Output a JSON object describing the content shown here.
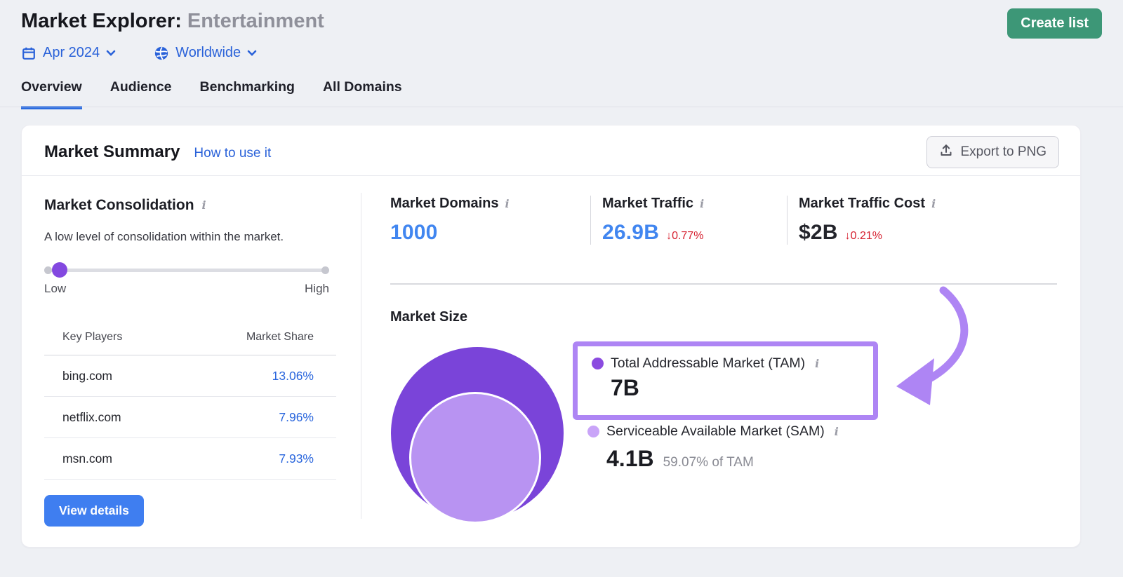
{
  "header": {
    "title_prefix": "Market Explorer:",
    "title_entity": "Entertainment",
    "create_list_button": "Create list",
    "date_filter": "Apr 2024",
    "region_filter": "Worldwide",
    "tabs": [
      {
        "label": "Overview",
        "active": true
      },
      {
        "label": "Audience",
        "active": false
      },
      {
        "label": "Benchmarking",
        "active": false
      },
      {
        "label": "All Domains",
        "active": false
      }
    ]
  },
  "summary_card": {
    "title": "Market Summary",
    "help_link": "How to use it",
    "export_button": "Export to PNG"
  },
  "consolidation": {
    "title": "Market Consolidation",
    "description": "A low level of consolidation within the market.",
    "slider": {
      "low": "Low",
      "high": "High",
      "level": "low"
    },
    "table": {
      "headers": [
        "Key Players",
        "Market Share"
      ],
      "rows": [
        {
          "domain": "bing.com",
          "share": "13.06%"
        },
        {
          "domain": "netflix.com",
          "share": "7.96%"
        },
        {
          "domain": "msn.com",
          "share": "7.93%"
        }
      ]
    },
    "view_details_button": "View details"
  },
  "stats": [
    {
      "label": "Market Domains",
      "value": "1000"
    },
    {
      "label": "Market Traffic",
      "value": "26.9B",
      "change": "↓0.77%"
    },
    {
      "label": "Market Traffic Cost",
      "value": "$2B",
      "change": "↓0.21%"
    }
  ],
  "market_size": {
    "title": "Market Size",
    "tam": {
      "label": "Total Addressable Market (TAM)",
      "value": "7B"
    },
    "sam": {
      "label": "Serviceable Available Market (SAM)",
      "value": "4.1B",
      "share_of_tam": "59.07% of TAM"
    }
  },
  "icons": {
    "date": "calendar-icon",
    "region": "globe-icon",
    "dropdowns": "chevron-down-icon",
    "export": "upload-icon",
    "tooltips": "info-icon",
    "negative_change": "down-arrow-glyph"
  },
  "colors": {
    "accent_blue": "#2a62d9",
    "value_blue": "#4186f0",
    "negative_red": "#d6202f",
    "green_button": "#3d9777",
    "primary_button": "#3f7ef0",
    "tam_circle": "#7a44d9",
    "sam_circle": "#b893f2",
    "highlight_purple": "#ae85f4",
    "page_background": "#eef0f4"
  }
}
